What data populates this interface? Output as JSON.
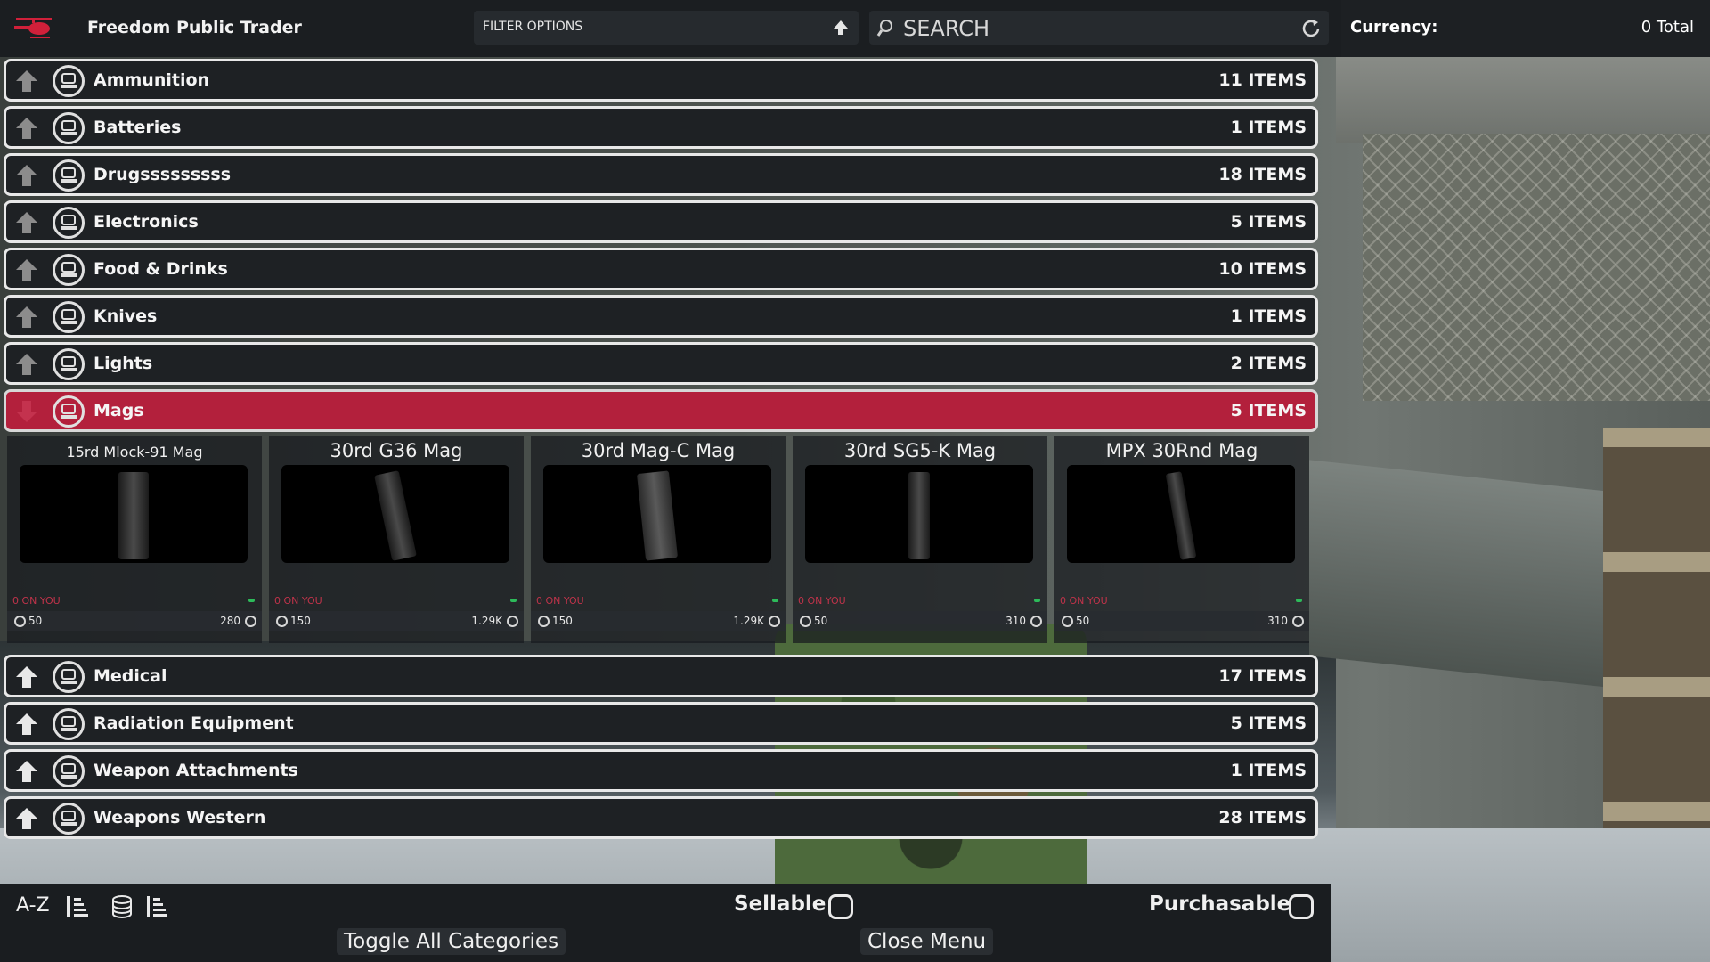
{
  "header": {
    "title": "Freedom Public Trader",
    "filter_label": "FILTER OPTIONS",
    "search_placeholder": "SEARCH",
    "currency_label": "Currency:",
    "currency_value": "0 Total"
  },
  "categories_top": [
    {
      "name": "Ammunition",
      "count": "11 ITEMS"
    },
    {
      "name": "Batteries",
      "count": "1 ITEMS"
    },
    {
      "name": "Drugsssssssss",
      "count": "18 ITEMS"
    },
    {
      "name": "Electronics",
      "count": "5 ITEMS"
    },
    {
      "name": "Food & Drinks",
      "count": "10 ITEMS"
    },
    {
      "name": "Knives",
      "count": "1 ITEMS"
    },
    {
      "name": "Lights",
      "count": "2 ITEMS"
    }
  ],
  "open_category": {
    "name": "Mags",
    "count": "5 ITEMS"
  },
  "items": [
    {
      "name": "15rd Mlock-91 Mag",
      "on_you": "0 ON YOU",
      "buy": "50",
      "sell": "280"
    },
    {
      "name": "30rd G36 Mag",
      "on_you": "0 ON YOU",
      "buy": "150",
      "sell": "1.29K"
    },
    {
      "name": "30rd Mag-C Mag",
      "on_you": "0 ON YOU",
      "buy": "150",
      "sell": "1.29K"
    },
    {
      "name": "30rd SG5-K Mag",
      "on_you": "0 ON YOU",
      "buy": "50",
      "sell": "310"
    },
    {
      "name": "MPX 30Rnd Mag",
      "on_you": "0 ON YOU",
      "buy": "50",
      "sell": "310"
    }
  ],
  "categories_bottom": [
    {
      "name": "Medical",
      "count": "17 ITEMS"
    },
    {
      "name": "Radiation Equipment",
      "count": "5 ITEMS"
    },
    {
      "name": "Weapon Attachments",
      "count": "1 ITEMS"
    },
    {
      "name": "Weapons Western",
      "count": "28 ITEMS"
    }
  ],
  "footer": {
    "sort_label": "A-Z",
    "sellable_label": "Sellable",
    "purchasable_label": "Purchasable",
    "toggle_label": "Toggle All Categories",
    "close_label": "Close Menu"
  },
  "colors": {
    "accent_open": "#b3203c",
    "on_you": "#c0334a",
    "heli": "#d0203a"
  },
  "icons": [
    "helicopter-icon",
    "arrow-up-icon",
    "search-icon",
    "refresh-icon",
    "coin-icon",
    "sort-icon",
    "coin-stack-icon"
  ]
}
